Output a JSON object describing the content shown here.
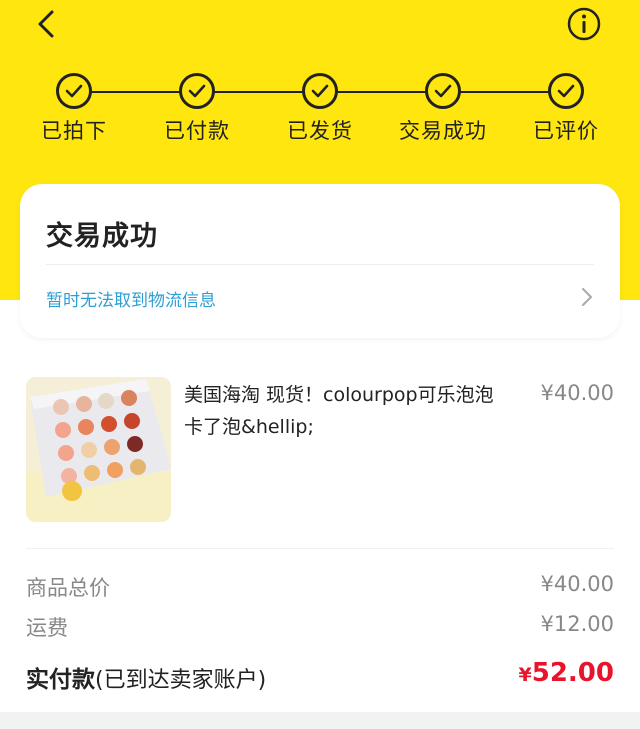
{
  "header": {
    "steps": [
      {
        "label": "已拍下"
      },
      {
        "label": "已付款"
      },
      {
        "label": "已发货"
      },
      {
        "label": "交易成功"
      },
      {
        "label": "已评价"
      }
    ]
  },
  "status_card": {
    "title": "交易成功",
    "logistics_text": "暂时无法取到物流信息"
  },
  "product": {
    "title": "美国海淘 现货！colourpop可乐泡泡卡了泡&hellip;",
    "price": "¥40.00"
  },
  "summary": {
    "subtotal_label": "商品总价",
    "subtotal_value": "¥40.00",
    "shipping_label": "运费",
    "shipping_value": "¥12.00",
    "paid_label": "实付款",
    "paid_note": "(已到达卖家账户)",
    "paid_currency": "¥",
    "paid_amount": "52.00"
  },
  "colors": {
    "brand_yellow": "#ffe60f",
    "link_blue": "#2c9fd6",
    "price_red": "#e8142c"
  },
  "icons": [
    "back-icon",
    "info-icon",
    "check-icon",
    "chevron-right-icon"
  ]
}
